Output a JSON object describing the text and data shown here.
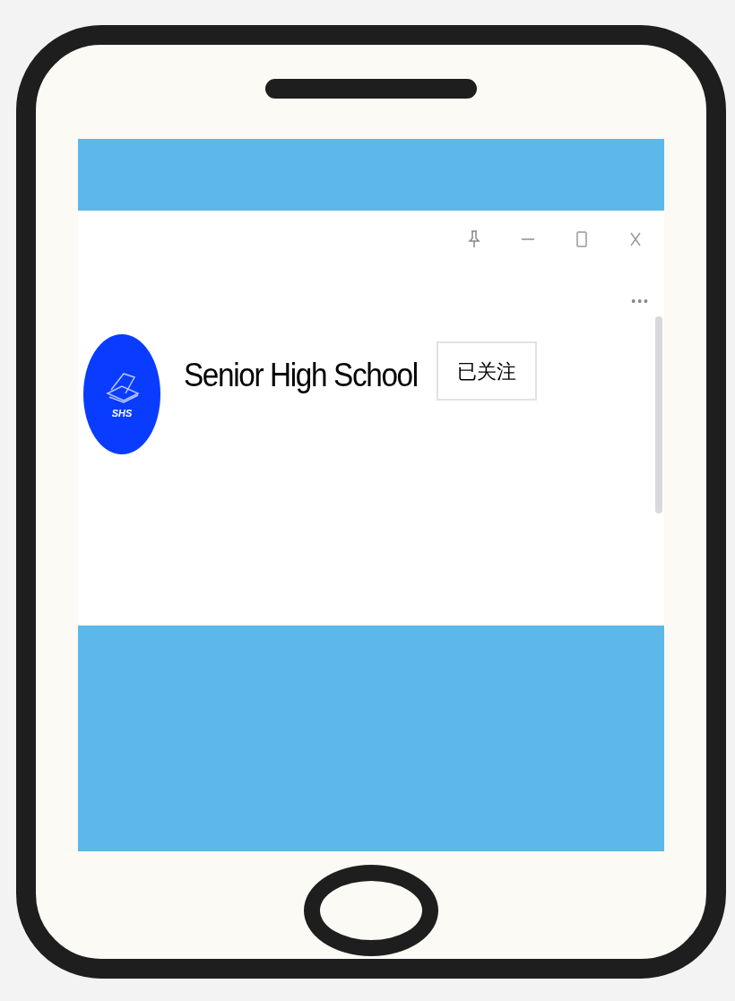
{
  "window": {
    "controls": [
      {
        "kind": "pin"
      },
      {
        "kind": "minimize"
      },
      {
        "kind": "maximize"
      },
      {
        "kind": "close"
      }
    ],
    "more_button": "•••"
  },
  "profile": {
    "logo_text": "SHS",
    "name": "Senior High School",
    "follow_button": {
      "label": "已关注",
      "followed": true
    }
  }
}
